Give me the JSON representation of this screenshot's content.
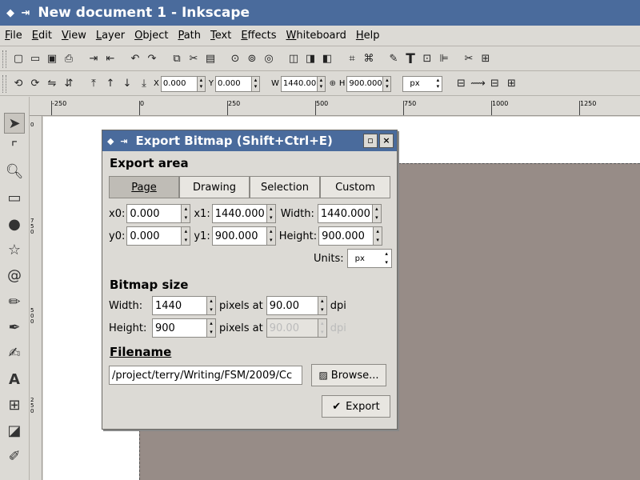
{
  "window": {
    "title": "New document 1 - Inkscape"
  },
  "menu": [
    "File",
    "Edit",
    "View",
    "Layer",
    "Object",
    "Path",
    "Text",
    "Effects",
    "Whiteboard",
    "Help"
  ],
  "toolbar2": {
    "x_label": "X",
    "x_value": "0.000",
    "y_label": "Y",
    "y_value": "0.000",
    "w_label": "W",
    "w_value": "1440.00",
    "h_label": "H",
    "h_value": "900.000",
    "units": "px"
  },
  "ruler": {
    "top_ticks": [
      "-250",
      "0",
      "250",
      "500",
      "750",
      "1000",
      "1250"
    ],
    "left_ticks": [
      "0",
      "7 5 0",
      "5 0 0",
      "2 5 0"
    ]
  },
  "dialog": {
    "title": "Export Bitmap (Shift+Ctrl+E)",
    "export_area_heading": "Export area",
    "tabs": [
      "Page",
      "Drawing",
      "Selection",
      "Custom"
    ],
    "active_tab": "Page",
    "x0_label": "x0:",
    "x0_value": "0.000",
    "x1_label": "x1:",
    "x1_value": "1440.000",
    "width_label": "Width:",
    "width_value": "1440.000",
    "y0_label": "y0:",
    "y0_value": "0.000",
    "y1_label": "y1:",
    "y1_value": "900.000",
    "height_label": "Height:",
    "height_value": "900.000",
    "units_label": "Units:",
    "units_value": "px",
    "bitmap_size_heading": "Bitmap size",
    "bm_width_label": "Width:",
    "bm_width_value": "1440",
    "bm_height_label": "Height:",
    "bm_height_value": "900",
    "pixels_at_1": "pixels at",
    "dpi_value_1": "90.00",
    "dpi_1": "dpi",
    "pixels_at_2": "pixels at",
    "dpi_value_2": "90.00",
    "dpi_2": "dpi",
    "filename_heading": "Filename",
    "filename_value": "/project/terry/Writing/FSM/2009/Cc",
    "browse_label": "Browse...",
    "export_label": "Export"
  }
}
